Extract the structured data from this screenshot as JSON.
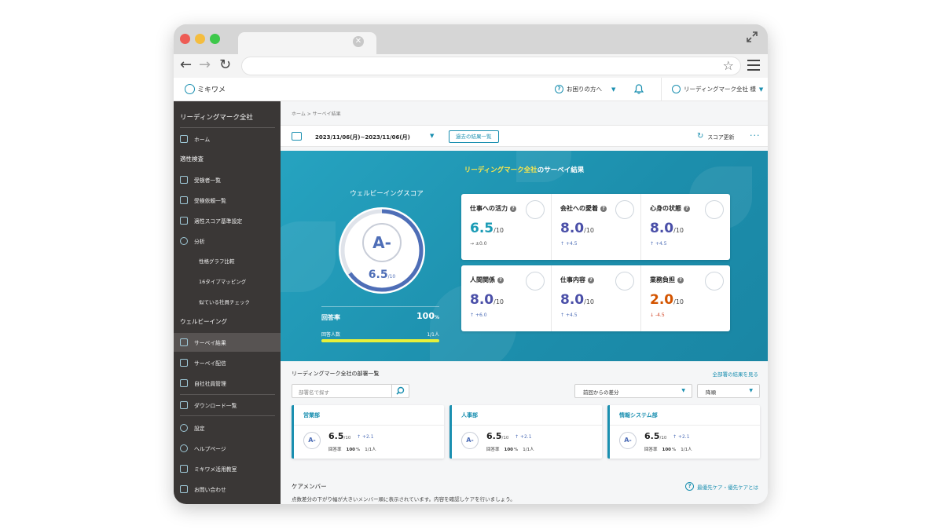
{
  "browser": {
    "address": ""
  },
  "header": {
    "logo_text": "ミキワメ",
    "help_label": "お困りの方へ",
    "user_label": "リーディングマーク全社 様"
  },
  "sidebar": {
    "org_name": "リーディングマーク全社",
    "home": "ホーム",
    "section_aptitude": "適性検査",
    "examinees": "受検者一覧",
    "requests": "受検依頼一覧",
    "score_settings": "適性スコア基準設定",
    "analysis": "分析",
    "graph_compare": "性格グラフ比較",
    "type_mapping": "16タイプマッピング",
    "similar_check": "似ている社員チェック",
    "section_wellbeing": "ウェルビーイング",
    "survey_results": "サーベイ結果",
    "survey_delivery": "サーベイ配信",
    "employee_mgmt": "自社社員管理",
    "downloads": "ダウンロード一覧",
    "settings": "設定",
    "help_page": "ヘルプページ",
    "classroom": "ミキワメ活用教室",
    "contact": "お問い合わせ"
  },
  "main": {
    "breadcrumb": "ホーム > サーベイ結果",
    "date_range": "2023/11/06(月)~2023/11/06(月)",
    "past_results_button": "過去の結果一覧",
    "refresh_label": "スコア更新",
    "more_label": "···"
  },
  "hero": {
    "title_org": "リーディングマーク全社",
    "title_suffix": "のサーベイ結果",
    "wellbeing_title": "ウェルビーイングスコア",
    "grade": "A-",
    "score": "6.5",
    "score_max": "/10",
    "score_fraction": 0.65,
    "response_label": "回答率",
    "response_value": "100",
    "response_unit": "%",
    "respondents_label": "回答人数",
    "respondents_value": "1/1人",
    "response_fraction": 1.0
  },
  "metrics": [
    {
      "label": "仕事への活力",
      "value": "6.5",
      "max": "/10",
      "delta": "±0.0",
      "arrow": "→",
      "color": "#1a9bb5",
      "delta_color": "#555555"
    },
    {
      "label": "会社への愛着",
      "value": "8.0",
      "max": "/10",
      "delta": "+4.5",
      "arrow": "↑",
      "color": "#4a4fa8",
      "delta_color": "#4e6eb7"
    },
    {
      "label": "心身の状態",
      "value": "8.0",
      "max": "/10",
      "delta": "+4.5",
      "arrow": "↑",
      "color": "#4a4fa8",
      "delta_color": "#4e6eb7"
    },
    {
      "label": "人間関係",
      "value": "8.0",
      "max": "/10",
      "delta": "+6.0",
      "arrow": "↑",
      "color": "#4a4fa8",
      "delta_color": "#4e6eb7"
    },
    {
      "label": "仕事内容",
      "value": "8.0",
      "max": "/10",
      "delta": "+4.5",
      "arrow": "↑",
      "color": "#4a4fa8",
      "delta_color": "#4e6eb7"
    },
    {
      "label": "業務負担",
      "value": "2.0",
      "max": "/10",
      "delta": "-4.5",
      "arrow": "↓",
      "color": "#d35400",
      "delta_color": "#d04020"
    }
  ],
  "departments": {
    "title": "リーディングマーク全社の部署一覧",
    "see_all_link": "全部署の結果を見る",
    "search_placeholder": "部署名で探す",
    "compare_select": "前回からの差分",
    "order_select": "降順",
    "items": [
      {
        "name": "営業部",
        "grade": "A-",
        "score": "6.5",
        "max": "/10",
        "delta": "+2.1",
        "resp_label": "回答率",
        "resp_value": "100",
        "resp_unit": "%",
        "count": "1/1人"
      },
      {
        "name": "人事部",
        "grade": "A-",
        "score": "6.5",
        "max": "/10",
        "delta": "+2.1",
        "resp_label": "回答率",
        "resp_value": "100",
        "resp_unit": "%",
        "count": "1/1人"
      },
      {
        "name": "情報システム部",
        "grade": "A-",
        "score": "6.5",
        "max": "/10",
        "delta": "+2.1",
        "resp_label": "回答率",
        "resp_value": "100",
        "resp_unit": "%",
        "count": "1/1人"
      }
    ]
  },
  "care": {
    "title": "ケアメンバー",
    "link": "最優先ケア・優先ケアとは",
    "description": "点数差分の下がり幅が大きいメンバー順に表示されています。内容を確認しケアを行いましょう。"
  },
  "colors": {
    "accent": "#1a8fb0",
    "sidebar": "#3a3736",
    "hero": "#1c8eac",
    "score_blue": "#4e6eb7"
  }
}
